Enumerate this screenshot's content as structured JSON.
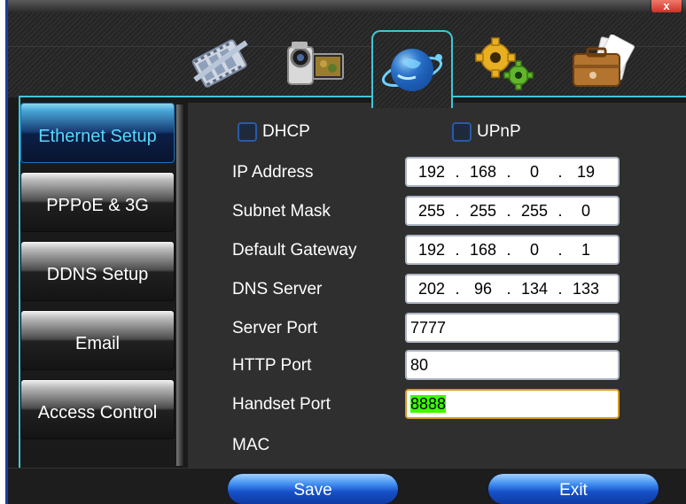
{
  "window": {
    "close_label": "x"
  },
  "tabs": [
    {
      "name": "record",
      "icon": "film-reel-icon"
    },
    {
      "name": "camera",
      "icon": "camcorder-icon"
    },
    {
      "name": "network",
      "icon": "globe-network-icon",
      "active": true
    },
    {
      "name": "system",
      "icon": "gears-icon"
    },
    {
      "name": "info",
      "icon": "briefcase-icon"
    }
  ],
  "sidebar": {
    "items": [
      {
        "label": "Ethernet Setup",
        "active": true
      },
      {
        "label": "PPPoE & 3G"
      },
      {
        "label": "DDNS Setup"
      },
      {
        "label": "Email"
      },
      {
        "label": "Access Control"
      }
    ]
  },
  "form": {
    "dhcp_label": "DHCP",
    "upnp_label": "UPnP",
    "dhcp_checked": false,
    "upnp_checked": false,
    "ip_label": "IP Address",
    "ip": [
      "192",
      "168",
      "0",
      "19"
    ],
    "subnet_label": "Subnet Mask",
    "subnet": [
      "255",
      "255",
      "255",
      "0"
    ],
    "gateway_label": "Default Gateway",
    "gateway": [
      "192",
      "168",
      "0",
      "1"
    ],
    "dns_label": "DNS Server",
    "dns": [
      "202",
      "96",
      "134",
      "133"
    ],
    "server_port_label": "Server Port",
    "server_port": "7777",
    "http_port_label": "HTTP Port",
    "http_port": "80",
    "handset_port_label": "Handset Port",
    "handset_port": "8888",
    "mac_label": "MAC"
  },
  "buttons": {
    "save": "Save",
    "exit": "Exit"
  },
  "colors": {
    "accent": "#41c6d6",
    "button_blue": "#1650c8",
    "selection": "#3cff00"
  }
}
